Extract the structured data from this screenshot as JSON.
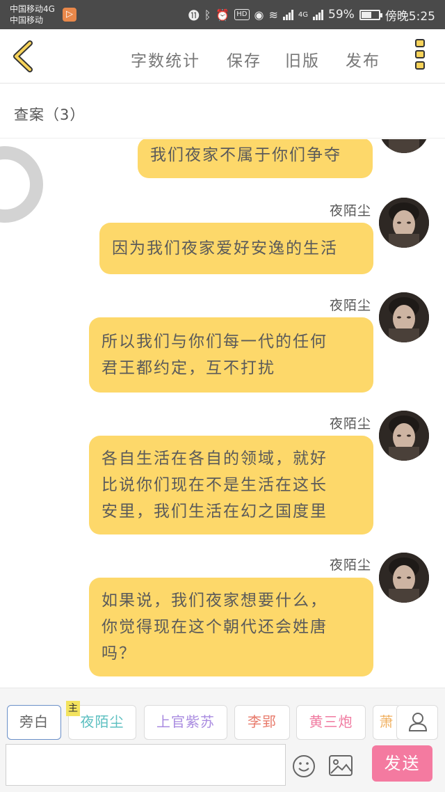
{
  "status_bar": {
    "carrier_1": "中国移动4G",
    "carrier_2": "中国移动",
    "badge": "▷",
    "network": "4G",
    "battery_percent": "59%",
    "battery_level": 0.59,
    "time": "傍晚5:25"
  },
  "toolbar": {
    "word_count": "字数统计",
    "save": "保存",
    "old_version": "旧版",
    "publish": "发布"
  },
  "section": {
    "title": "查案（3）"
  },
  "messages": [
    {
      "speaker": "",
      "text": "我们夜家不属于你们争夺"
    },
    {
      "speaker": "夜陌尘",
      "text": "因为我们夜家爱好安逸的生活"
    },
    {
      "speaker": "夜陌尘",
      "line1": "所以我们与你们每一代的任何",
      "line2": "君王都约定，互不打扰"
    },
    {
      "speaker": "夜陌尘",
      "line1": "各自生活在各自的领域，就好",
      "line2": "比说你们现在不是生活在这长",
      "line3": "安里，我们生活在幻之国度里"
    },
    {
      "speaker": "夜陌尘",
      "line1": "如果说，我们夜家想要什么，",
      "line2": "你觉得现在这个朝代还会姓唐",
      "line3": "吗？"
    }
  ],
  "roles": [
    {
      "label": "旁白",
      "color": "#777777"
    },
    {
      "label": "夜陌尘",
      "color": "#5bbfc0"
    },
    {
      "label": "上官紫苏",
      "color": "#a98be0"
    },
    {
      "label": "李郢",
      "color": "#e87b6c"
    },
    {
      "label": "黄三炮",
      "color": "#f07aa0"
    },
    {
      "label": "萧",
      "color": "#f0b060"
    }
  ],
  "main_badge": "主",
  "composer": {
    "input_value": "",
    "send_label": "发送"
  },
  "colors": {
    "bubble": "#fdd86a",
    "send": "#f47aa0",
    "accent": "#f7d35a"
  }
}
